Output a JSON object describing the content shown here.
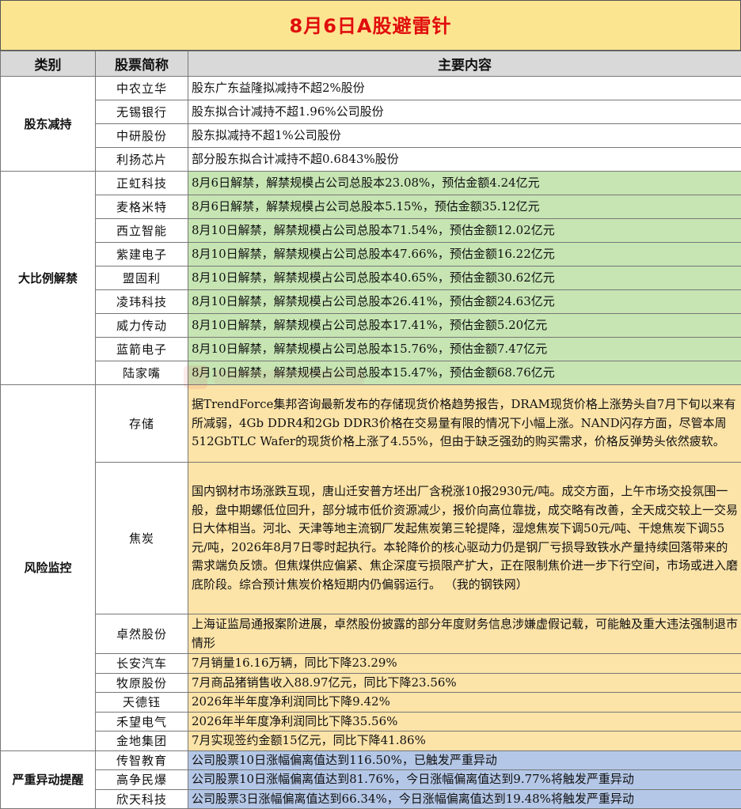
{
  "title": "8月6日A股避雷针",
  "headers": {
    "category": "类别",
    "stock": "股票简称",
    "content": "主要内容"
  },
  "groups": [
    {
      "category": "股东减持",
      "rows": [
        {
          "stock": "中农立华",
          "content": "股东广东益隆拟减持不超2%股份"
        },
        {
          "stock": "无锡银行",
          "content": "股东拟合计减持不超1.96%公司股份"
        },
        {
          "stock": "中研股份",
          "content": "股东拟减持不超1%公司股份"
        },
        {
          "stock": "利扬芯片",
          "content": "部分股东拟合计减持不超0.6843%股份"
        }
      ]
    },
    {
      "category": "大比例解禁",
      "rows": [
        {
          "stock": "正虹科技",
          "content": "8月6日解禁，解禁规模占公司总股本23.08%，预估金额4.24亿元"
        },
        {
          "stock": "麦格米特",
          "content": "8月6日解禁，解禁规模占公司总股本5.15%，预估金额35.12亿元"
        },
        {
          "stock": "西立智能",
          "content": "8月10日解禁，解禁规模占公司总股本71.54%，预估金额12.02亿元"
        },
        {
          "stock": "紫建电子",
          "content": "8月10日解禁，解禁规模占公司总股本47.66%，预估金额16.22亿元"
        },
        {
          "stock": "盟固利",
          "content": "8月10日解禁，解禁规模占公司总股本40.65%，预估金额30.62亿元"
        },
        {
          "stock": "凌玮科技",
          "content": "8月10日解禁，解禁规模占公司总股本26.41%，预估金额24.63亿元"
        },
        {
          "stock": "威力传动",
          "content": "8月10日解禁，解禁规模占公司总股本17.41%，预估金额5.20亿元"
        },
        {
          "stock": "蓝箭电子",
          "content": "8月10日解禁，解禁规模占公司总股本15.76%，预估金额7.47亿元"
        },
        {
          "stock": "陆家嘴",
          "content": "8月10日解禁，解禁规模占公司总股本15.47%，预估金额68.76亿元"
        }
      ]
    },
    {
      "category": "风险监控",
      "rows": [
        {
          "stock": "存储",
          "content": "据TrendForce集邦咨询最新发布的存储现货价格趋势报告，DRAM现货价格上涨势头自7月下旬以来有所减弱，4Gb DDR4和2Gb DDR3价格在交易量有限的情况下小幅上涨。NAND闪存方面，尽管本周512GbTLC Wafer的现货价格上涨了4.55%，但由于缺乏强劲的购买需求，价格反弹势头依然疲软。"
        },
        {
          "stock": "焦炭",
          "content": "国内钢材市场涨跌互现，唐山迁安普方坯出厂含税涨10报2930元/吨。成交方面，上午市场交投氛围一般，盘中期螺低位回升，部分城市低价资源减少，报价向高位靠拢，成交略有改善，全天成交较上一交易日大体相当。河北、天津等地主流钢厂发起焦炭第三轮提降，湿熄焦炭下调50元/吨、干熄焦炭下调55元/吨，2026年8月7日零时起执行。本轮降价的核心驱动力仍是钢厂亏损导致铁水产量持续回落带来的需求端负反馈。但焦煤供应偏紧、焦企深度亏损限产扩大，正在限制焦价进一步下行空间，市场或进入磨底阶段。综合预计焦炭价格短期内仍偏弱运行。 （我的钢铁网）"
        },
        {
          "stock": "卓然股份",
          "content": "上海证监局通报案阶进展，卓然股份披露的部分年度财务信息涉嫌虚假记载，可能触及重大违法强制退市情形"
        },
        {
          "stock": "长安汽车",
          "content": "7月销量16.16万辆，同比下降23.29%"
        },
        {
          "stock": "牧原股份",
          "content": "7月商品猪销售收入88.97亿元，同比下降23.56%"
        },
        {
          "stock": "天德钰",
          "content": "2026年半年度净利润同比下降9.42%"
        },
        {
          "stock": "禾望电气",
          "content": "2026年半年度净利润同比下降35.56%"
        },
        {
          "stock": "金地集团",
          "content": "7月实现签约金额15亿元，同比下降41.86%"
        }
      ]
    },
    {
      "category": "严重异动提醒",
      "rows": [
        {
          "stock": "传智教育",
          "content": "公司股票10日涨幅偏离值达到116.50%，已触发严重异动"
        },
        {
          "stock": "高争民爆",
          "content": "公司股票10日涨幅偏离值达到81.76%，今日涨幅偏离值达到9.77%将触发严重异动"
        },
        {
          "stock": "欣天科技",
          "content": "公司股票3日涨幅偏离值达到66.34%，今日涨幅偏离值达到19.48%将触发严重异动"
        }
      ]
    }
  ],
  "colors": {
    "title_bg": "#fce591",
    "title_text": "#e00d0d",
    "header_bg": "#d9d9d9",
    "category_text": "#e00d0d",
    "unlock_bg": "#c6e5b3",
    "risk_bg": "#fce3a8",
    "alert_bg": "#b4c7e7"
  }
}
